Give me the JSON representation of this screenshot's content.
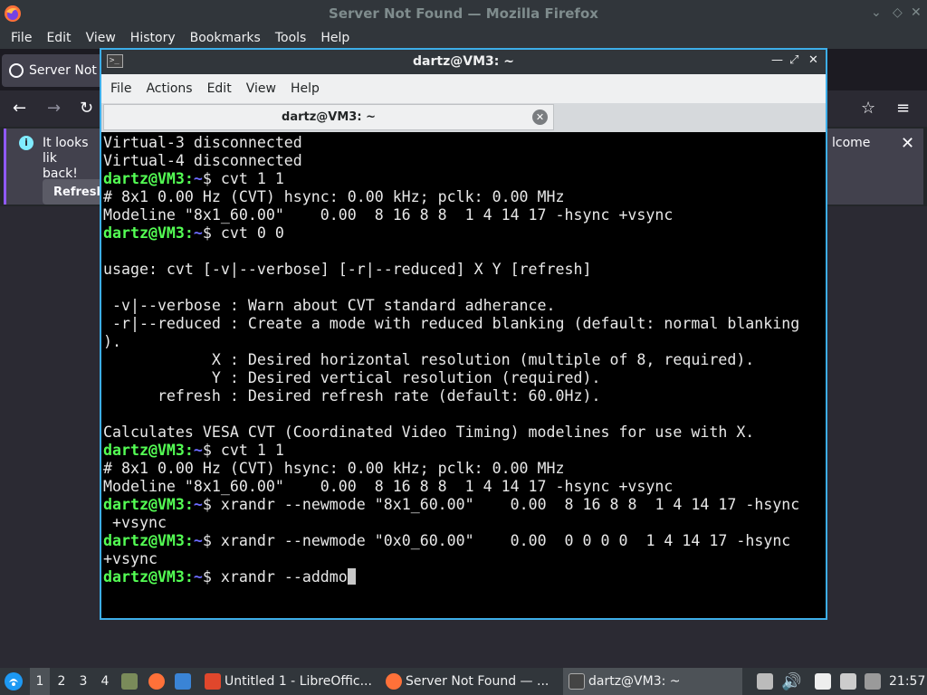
{
  "firefox": {
    "window_title": "Server Not Found — Mozilla Firefox",
    "menu": [
      "File",
      "Edit",
      "View",
      "History",
      "Bookmarks",
      "Tools",
      "Help"
    ],
    "tab_title": "Server Not F",
    "notice": {
      "text": "It looks like back!",
      "text_line1": "It looks lik",
      "text_line2": "back!",
      "refresh_label": "Refresh",
      "right_text": "lcome"
    }
  },
  "terminal": {
    "window_title": "dartz@VM3: ~",
    "menu": [
      "File",
      "Actions",
      "Edit",
      "View",
      "Help"
    ],
    "tab_label": "dartz@VM3: ~",
    "lines": [
      {
        "type": "out",
        "text": "Virtual-3 disconnected"
      },
      {
        "type": "out",
        "text": "Virtual-4 disconnected"
      },
      {
        "type": "cmd",
        "user": "dartz@VM3",
        "path": "~",
        "cmd": " cvt 1 1"
      },
      {
        "type": "out",
        "text": "# 8x1 0.00 Hz (CVT) hsync: 0.00 kHz; pclk: 0.00 MHz"
      },
      {
        "type": "out",
        "text": "Modeline \"8x1_60.00\"    0.00  8 16 8 8  1 4 14 17 -hsync +vsync"
      },
      {
        "type": "cmd",
        "user": "dartz@VM3",
        "path": "~",
        "cmd": " cvt 0 0"
      },
      {
        "type": "out",
        "text": ""
      },
      {
        "type": "out",
        "text": "usage: cvt [-v|--verbose] [-r|--reduced] X Y [refresh]"
      },
      {
        "type": "out",
        "text": ""
      },
      {
        "type": "out",
        "text": " -v|--verbose : Warn about CVT standard adherance."
      },
      {
        "type": "out",
        "text": " -r|--reduced : Create a mode with reduced blanking (default: normal blanking"
      },
      {
        "type": "out",
        "text": ")."
      },
      {
        "type": "out",
        "text": "            X : Desired horizontal resolution (multiple of 8, required)."
      },
      {
        "type": "out",
        "text": "            Y : Desired vertical resolution (required)."
      },
      {
        "type": "out",
        "text": "      refresh : Desired refresh rate (default: 60.0Hz)."
      },
      {
        "type": "out",
        "text": ""
      },
      {
        "type": "out",
        "text": "Calculates VESA CVT (Coordinated Video Timing) modelines for use with X."
      },
      {
        "type": "cmd",
        "user": "dartz@VM3",
        "path": "~",
        "cmd": " cvt 1 1"
      },
      {
        "type": "out",
        "text": "# 8x1 0.00 Hz (CVT) hsync: 0.00 kHz; pclk: 0.00 MHz"
      },
      {
        "type": "out",
        "text": "Modeline \"8x1_60.00\"    0.00  8 16 8 8  1 4 14 17 -hsync +vsync"
      },
      {
        "type": "cmd",
        "user": "dartz@VM3",
        "path": "~",
        "cmd": " xrandr --newmode \"8x1_60.00\"    0.00  8 16 8 8  1 4 14 17 -hsync"
      },
      {
        "type": "out",
        "text": " +vsync"
      },
      {
        "type": "cmd",
        "user": "dartz@VM3",
        "path": "~",
        "cmd": " xrandr --newmode \"0x0_60.00\"    0.00  0 0 0 0  1 4 14 17 -hsync"
      },
      {
        "type": "out",
        "text": "+vsync"
      },
      {
        "type": "cmd",
        "user": "dartz@VM3",
        "path": "~",
        "cmd": " xrandr --addmo",
        "cursor": true
      }
    ],
    "colors": {
      "user": "#54ff54",
      "path": "#6b6bff",
      "text": "#e8e8e8",
      "background": "#000000"
    }
  },
  "taskbar": {
    "desktops": [
      "1",
      "2",
      "3",
      "4"
    ],
    "active_desktop": "1",
    "tasks": [
      {
        "label": "Untitled 1 - LibreOffic...",
        "icon": "libreoffice-writer-icon"
      },
      {
        "label": "Server Not Found — ...",
        "icon": "firefox-icon"
      },
      {
        "label": "dartz@VM3: ~",
        "icon": "terminal-icon"
      }
    ],
    "clock": "21:57"
  }
}
